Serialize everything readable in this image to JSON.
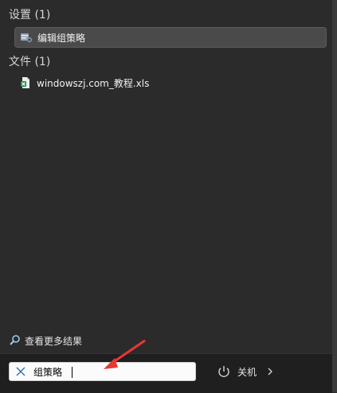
{
  "sections": [
    {
      "title": "设置 (1)",
      "items": [
        {
          "label": "编辑组策略",
          "icon": "group-policy-icon"
        }
      ]
    },
    {
      "title": "文件 (1)",
      "items": [
        {
          "label": "windowszj.com_教程.xls",
          "icon": "excel-file-icon"
        }
      ]
    }
  ],
  "more_results": {
    "label": "查看更多结果",
    "icon": "search-icon"
  },
  "search": {
    "value": "组策略",
    "clear_icon": "close-icon"
  },
  "power": {
    "label": "关机",
    "icon": "power-icon",
    "chevron": "chevron-right-icon"
  },
  "colors": {
    "panel": "#2b2b2b",
    "bottom_bar": "#1f1f1f",
    "selected": "#4a4a4a",
    "annotation_arrow": "#e53935"
  }
}
